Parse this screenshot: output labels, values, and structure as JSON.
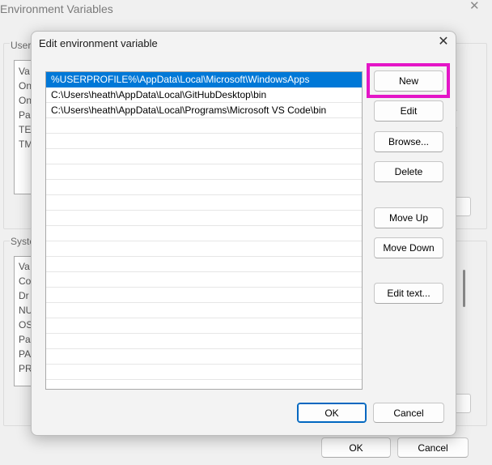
{
  "background_window": {
    "title": "Environment Variables",
    "user_group_label": "User",
    "user_rows": [
      "Va",
      "On",
      "On",
      "Pa",
      "TE",
      "TM"
    ],
    "system_group_label": "Syste",
    "system_rows": [
      "Va",
      "Co",
      "Dr",
      "NU",
      "OS",
      "Pa",
      "PA",
      "PR"
    ],
    "ok_label": "OK",
    "cancel_label": "Cancel"
  },
  "dialog": {
    "title": "Edit environment variable",
    "entries": [
      "%USERPROFILE%\\AppData\\Local\\Microsoft\\WindowsApps",
      "C:\\Users\\heath\\AppData\\Local\\GitHubDesktop\\bin",
      "C:\\Users\\heath\\AppData\\Local\\Programs\\Microsoft VS Code\\bin"
    ],
    "selected_index": 0,
    "buttons": {
      "new": "New",
      "edit": "Edit",
      "browse": "Browse...",
      "delete": "Delete",
      "move_up": "Move Up",
      "move_down": "Move Down",
      "edit_text": "Edit text..."
    },
    "ok_label": "OK",
    "cancel_label": "Cancel"
  },
  "colors": {
    "selection": "#0078d7",
    "highlight": "#e415c7",
    "primary_border": "#0067c0"
  },
  "icons": {
    "close": "close-icon"
  }
}
